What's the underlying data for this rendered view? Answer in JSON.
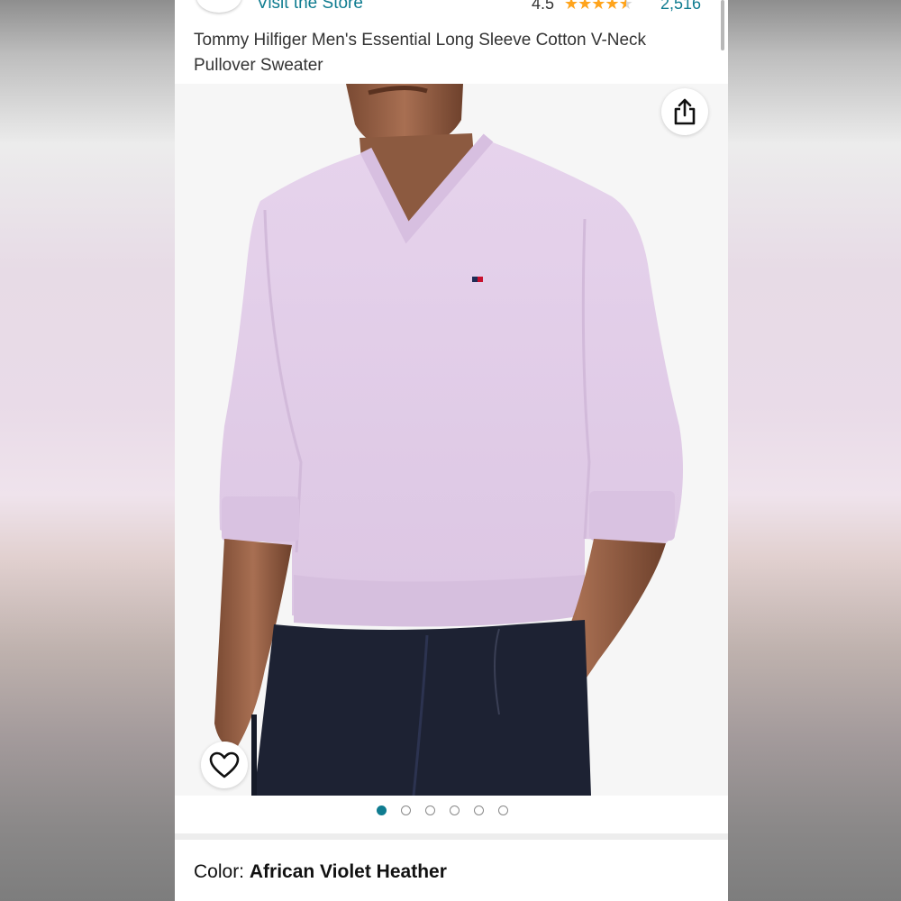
{
  "header": {
    "store_link": "Visit the Store",
    "rating_value": "4.5",
    "rating_stars": 4.5,
    "review_count": "2,516"
  },
  "product": {
    "title": "Tommy Hilfiger Men's Essential Long Sleeve Cotton V-Neck Pullover Sweater"
  },
  "gallery": {
    "total_images": 6,
    "active_index": 0
  },
  "color": {
    "label": "Color: ",
    "value": "African Violet Heather"
  },
  "icons": {
    "share": "share-icon",
    "favorite": "heart-icon",
    "brand": "brand-logo"
  },
  "colors": {
    "link": "#0f7c90",
    "star": "#ffa41c",
    "sweater": "#e3cfe8",
    "jeans": "#1d2233"
  }
}
